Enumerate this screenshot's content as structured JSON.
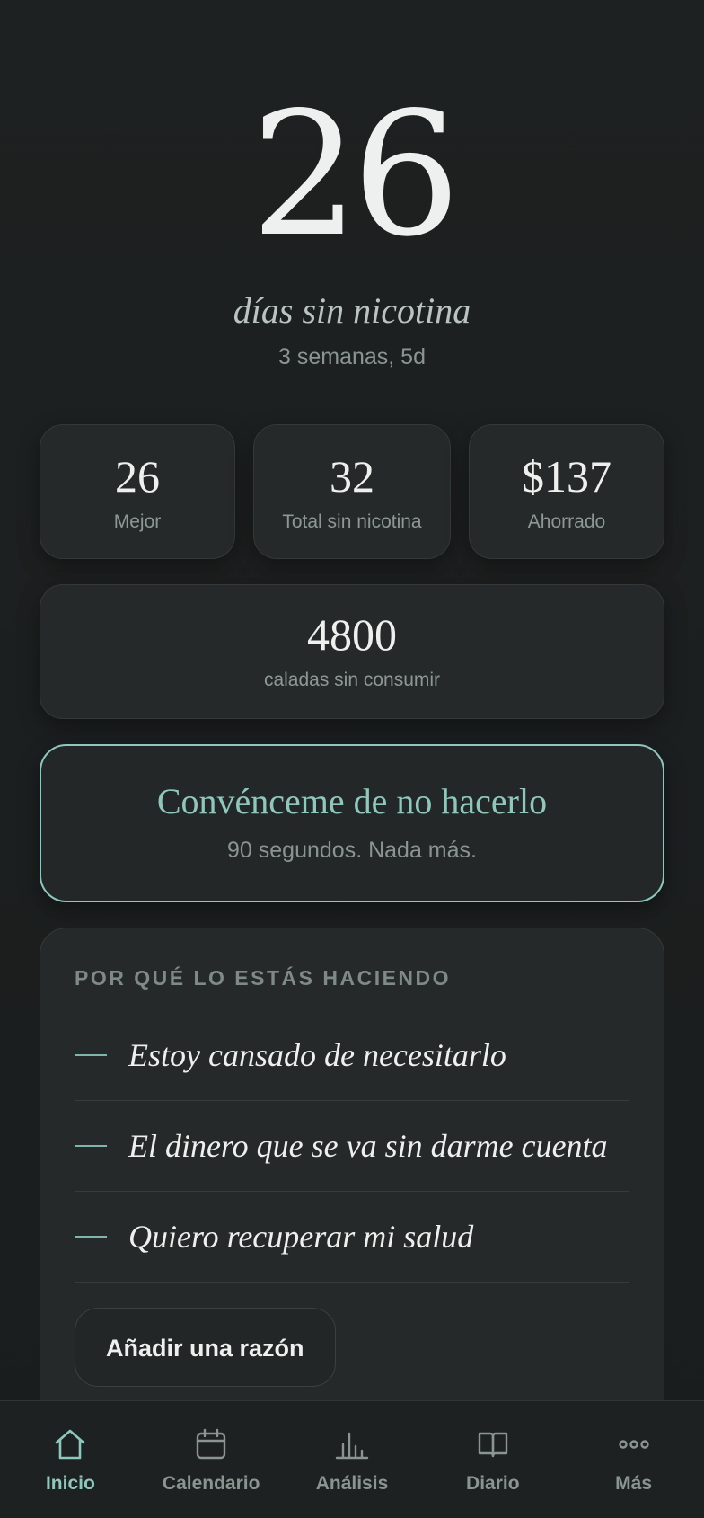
{
  "hero": {
    "days": "26",
    "label": "días sin nicotina",
    "duration": "3 semanas, 5d"
  },
  "stats": [
    {
      "value": "26",
      "label": "Mejor"
    },
    {
      "value": "32",
      "label": "Total sin nicotina"
    },
    {
      "value": "$137",
      "label": "Ahorrado"
    }
  ],
  "puffs": {
    "value": "4800",
    "label": "caladas sin consumir"
  },
  "convince": {
    "title": "Convénceme de no hacerlo",
    "subtitle": "90 segundos. Nada más."
  },
  "reasons": {
    "title": "POR QUÉ LO ESTÁS HACIENDO",
    "items": [
      "Estoy cansado de necesitarlo",
      "El dinero que se va sin darme cuenta",
      "Quiero recuperar mi salud"
    ],
    "add_label": "Añadir una razón"
  },
  "nav": {
    "items": [
      {
        "label": "Inicio",
        "icon": "home-icon",
        "active": true
      },
      {
        "label": "Calendario",
        "icon": "calendar-icon",
        "active": false
      },
      {
        "label": "Análisis",
        "icon": "bar-chart-icon",
        "active": false
      },
      {
        "label": "Diario",
        "icon": "book-icon",
        "active": false
      },
      {
        "label": "Más",
        "icon": "more-dots-icon",
        "active": false
      }
    ]
  },
  "colors": {
    "background": "#1c2020",
    "card": "#252929",
    "accent": "#8ec8bc",
    "text": "#eef0ee",
    "muted": "#8a9591"
  }
}
